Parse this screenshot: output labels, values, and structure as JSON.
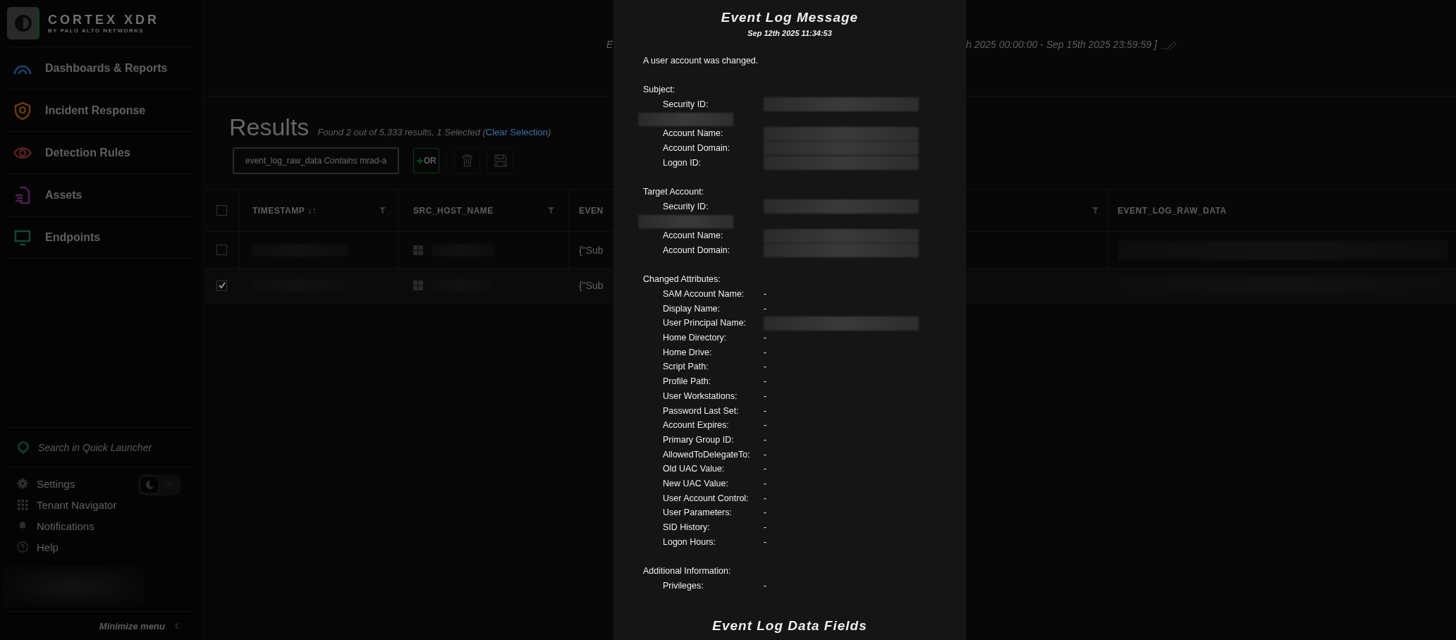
{
  "sidebar": {
    "brand": "CORTEX XDR",
    "brand_sub": "BY PALO ALTO NETWORKS",
    "nav": [
      {
        "label": "Dashboards & Reports",
        "kind": "gauge",
        "color": "#1d3b5e"
      },
      {
        "label": "Incident Response",
        "kind": "shield",
        "color": "#6a3a10"
      },
      {
        "label": "Detection Rules",
        "kind": "eye",
        "color": "#5a2222"
      },
      {
        "label": "Assets",
        "kind": "document",
        "color": "#4c2050"
      },
      {
        "label": "Endpoints",
        "kind": "monitor",
        "color": "#134536"
      }
    ],
    "search": {
      "placeholder": "Search in Quick Launcher"
    },
    "theme": [
      {
        "kind": "dark",
        "selected": true
      },
      {
        "kind": "light",
        "selected": false
      }
    ],
    "links": [
      {
        "label": "Settings",
        "kind": "gear"
      },
      {
        "label": "Tenant Navigator",
        "kind": "grid"
      },
      {
        "label": "Notifications",
        "kind": "bell"
      },
      {
        "label": "Help",
        "kind": "help"
      }
    ],
    "minimize": "Minimize menu"
  },
  "header": {
    "left_fragment": "E",
    "right_fragment": "h 2025 00:00:00 - Sep 15th 2025 23:59:59 ]"
  },
  "results": {
    "title": "Results",
    "summary": "Found 2 out of 5,333 results, 1 Selected (",
    "link": "Clear Selection",
    "summary_end": ")"
  },
  "toolbar": {
    "filter": "event_log_raw_data *Contains* mrad-a",
    "or_button": "OR"
  },
  "table": {
    "all_checked": false,
    "columns": [
      {
        "label": "TIMESTAMP ↓↑",
        "filter": true
      },
      {
        "label": "SRC_HOST_NAME",
        "filter": true
      },
      {
        "label": "EVEN",
        "filter": true
      },
      {
        "label": "EVENT_LOG_RAW_DATA",
        "filter": false
      }
    ],
    "rows": [
      {
        "checked": false,
        "event": "{\"Sub"
      },
      {
        "checked": true,
        "event": "{\"Sub"
      }
    ]
  },
  "modal": {
    "title": "Event Log Message",
    "date": "Sep 12th 2025 11:34:53",
    "summary": "A user account was changed.",
    "sections": [
      {
        "heading": "Subject:",
        "fields": [
          {
            "label": "Security ID:",
            "kind": "redacted_wrapped"
          },
          {
            "label": "Account Name:",
            "kind": "redacted"
          },
          {
            "label": "Account Domain:",
            "kind": "redacted"
          },
          {
            "label": "Logon ID:",
            "kind": "redacted"
          }
        ]
      },
      {
        "heading": "Target Account:",
        "fields": [
          {
            "label": "Security ID:",
            "kind": "redacted_wrapped"
          },
          {
            "label": "Account Name:",
            "kind": "redacted"
          },
          {
            "label": "Account Domain:",
            "kind": "redacted"
          }
        ]
      },
      {
        "heading": "Changed Attributes:",
        "fields": [
          {
            "label": "SAM Account Name:",
            "kind": "text",
            "value": "-"
          },
          {
            "label": "Display Name:",
            "kind": "text",
            "value": "-"
          },
          {
            "label": "User Principal Name:",
            "kind": "redacted"
          },
          {
            "label": "Home Directory:",
            "kind": "text",
            "value": "-"
          },
          {
            "label": "Home Drive:",
            "kind": "text",
            "value": "-"
          },
          {
            "label": "Script Path:",
            "kind": "text",
            "value": "-"
          },
          {
            "label": "Profile Path:",
            "kind": "text",
            "value": "-"
          },
          {
            "label": "User Workstations:",
            "kind": "text",
            "value": "-"
          },
          {
            "label": "Password Last Set:",
            "kind": "text",
            "value": "-"
          },
          {
            "label": "Account Expires:",
            "kind": "text",
            "value": "-"
          },
          {
            "label": "Primary Group ID:",
            "kind": "text",
            "value": "-"
          },
          {
            "label": "AllowedToDelegateTo:",
            "kind": "text",
            "value": "-"
          },
          {
            "label": "Old UAC Value:",
            "kind": "text",
            "value": "-"
          },
          {
            "label": "New UAC Value:",
            "kind": "text",
            "value": "-"
          },
          {
            "label": "User Account Control:",
            "kind": "text",
            "value": "-"
          },
          {
            "label": "User Parameters:",
            "kind": "text",
            "value": "-"
          },
          {
            "label": "SID History:",
            "kind": "text",
            "value": "-"
          },
          {
            "label": "Logon Hours:",
            "kind": "text",
            "value": "-"
          }
        ]
      },
      {
        "heading": "Additional Information:",
        "fields": [
          {
            "label": "Privileges:",
            "kind": "text",
            "value": "-"
          }
        ]
      }
    ],
    "footer_title": "Event Log Data Fields"
  }
}
